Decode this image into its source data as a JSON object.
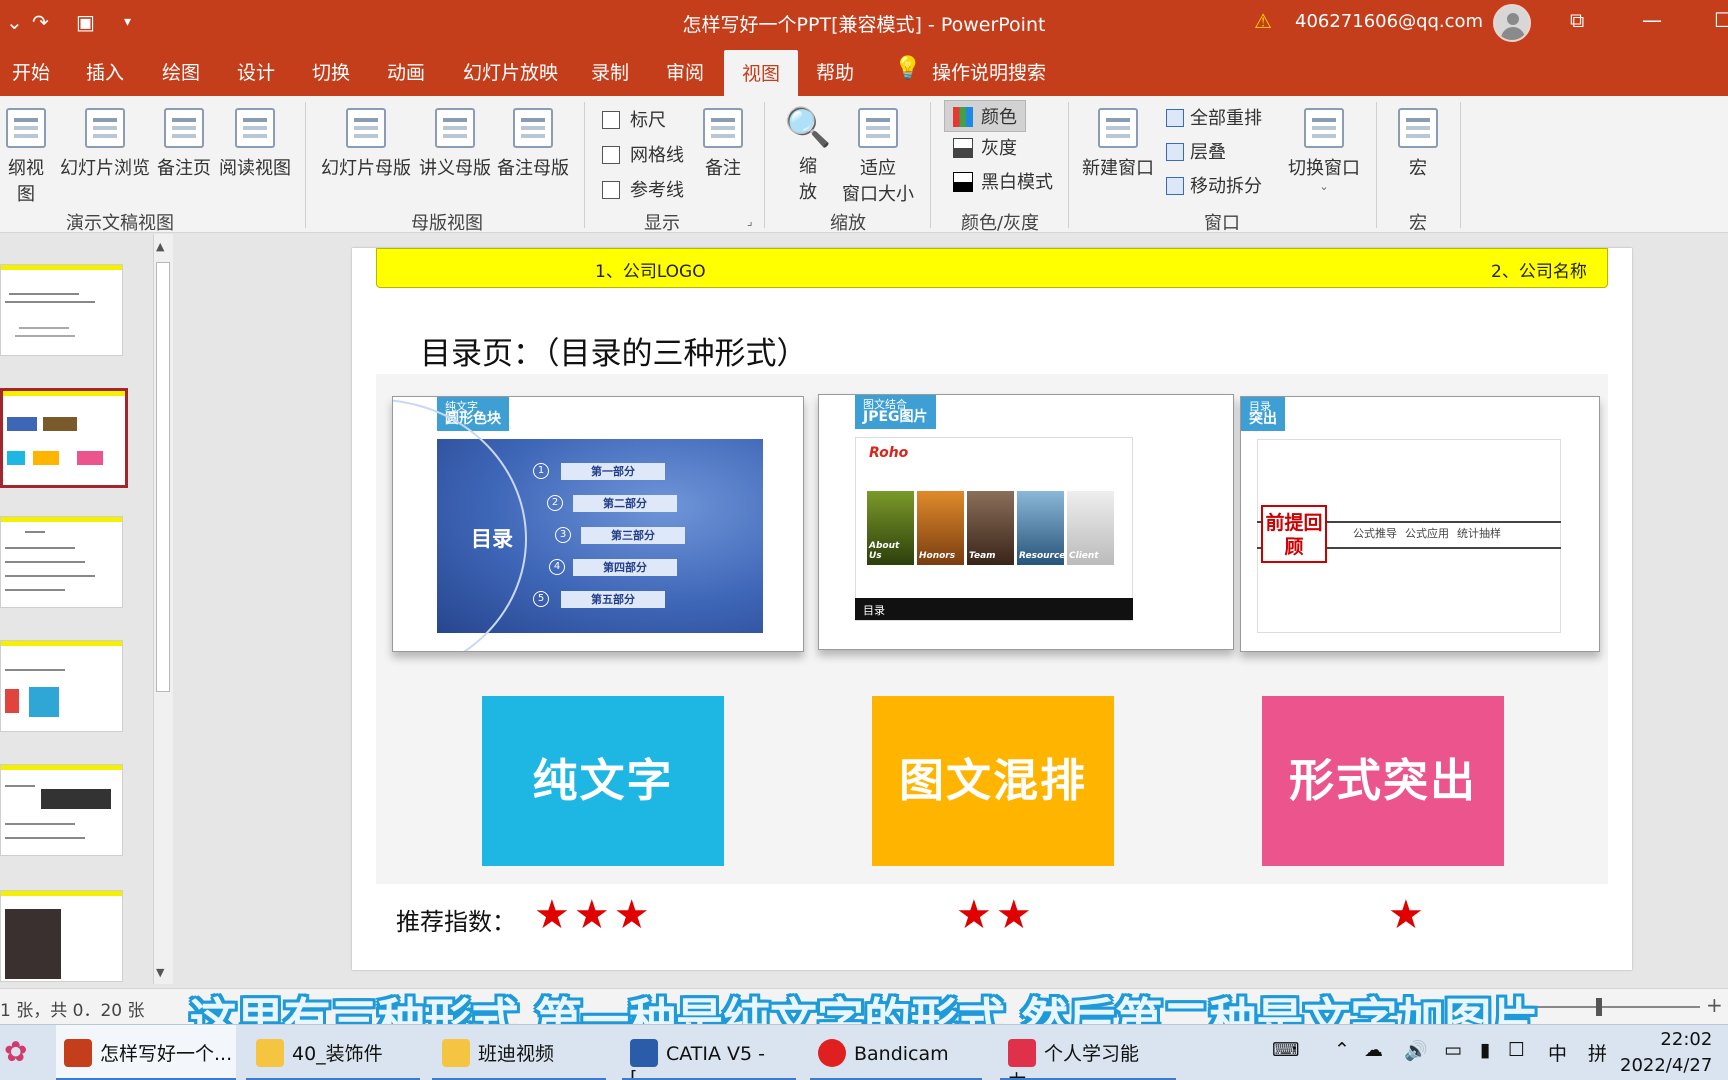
{
  "titlebar": {
    "doc_title": "怎样写好一个PPT[兼容模式]  -  PowerPoint",
    "account": "406271606@qq.com",
    "accent": "#c43e1c"
  },
  "tabs": [
    "开始",
    "插入",
    "绘图",
    "设计",
    "切换",
    "动画",
    "幻灯片放映",
    "录制",
    "审阅",
    "视图",
    "帮助"
  ],
  "active_tab": "视图",
  "search_label": "操作说明搜索",
  "ribbon": {
    "presentation_views": {
      "label": "演示文稿视图",
      "items": [
        "纲视图",
        "幻灯片浏览",
        "备注页",
        "阅读视图"
      ]
    },
    "master_views": {
      "label": "母版视图",
      "items": [
        "幻灯片母版",
        "讲义母版",
        "备注母版"
      ]
    },
    "show": {
      "label": "显示",
      "checkboxes": [
        "标尺",
        "网格线",
        "参考线"
      ],
      "notes": "备注"
    },
    "zoom": {
      "label": "缩放",
      "zoom_top": "缩",
      "zoom_bottom": "放",
      "fit_top": "适应",
      "fit_bottom": "窗口大小"
    },
    "color": {
      "label": "颜色/灰度",
      "items": [
        "颜色",
        "灰度",
        "黑白模式"
      ]
    },
    "window": {
      "label": "窗口",
      "new_window": "新建窗口",
      "items": [
        "全部重排",
        "层叠",
        "移动拆分"
      ],
      "switch": "切换窗口"
    },
    "macro": {
      "label": "宏",
      "item": "宏"
    }
  },
  "slide": {
    "header_left": "1、公司LOGO",
    "header_right": "2、公司名称",
    "title": "目录页：（目录的三种形式）",
    "previews": [
      {
        "tag_small": "纯文字",
        "tag_big": "圆形色块",
        "center": "目录",
        "parts": [
          "第一部分",
          "第二部分",
          "第三部分",
          "第四部分",
          "第五部分"
        ]
      },
      {
        "tag_small": "图文结合",
        "tag_big": "JPEG图片",
        "brand": "Roho",
        "photos": [
          "About Us",
          "Honors",
          "Team",
          "Resources",
          "Client"
        ],
        "footer": "目录"
      },
      {
        "tag_small": "目录",
        "tag_big": "突出",
        "box": "前提回顾",
        "cols": [
          "公式推导",
          "公式应用",
          "统计抽样"
        ]
      }
    ],
    "tiles": [
      {
        "label": "纯文字",
        "color": "#1eb6e3"
      },
      {
        "label": "图文混排",
        "color": "#ffb400"
      },
      {
        "label": "形式突出",
        "color": "#eb548c"
      }
    ],
    "rating_label": "推荐指数：",
    "ratings": [
      {
        "stars": "★★★",
        "value": 3
      },
      {
        "stars": "★★",
        "value": 2
      },
      {
        "stars": "★",
        "value": 1
      }
    ]
  },
  "statusbar": {
    "slide_info": "1 张，共 0．20 张"
  },
  "subtitle": "这里有三种形式 第一种是纯文字的形式 然后第二种是文字加图片",
  "taskbar": {
    "items": [
      "怎样写好一个...",
      "40_装饰件",
      "班迪视频",
      "CATIA V5 - [...",
      "Bandicam",
      "个人学习能力..."
    ],
    "ime_1": "中",
    "ime_2": "拼",
    "time": "22:02",
    "date": "2022/4/27"
  }
}
